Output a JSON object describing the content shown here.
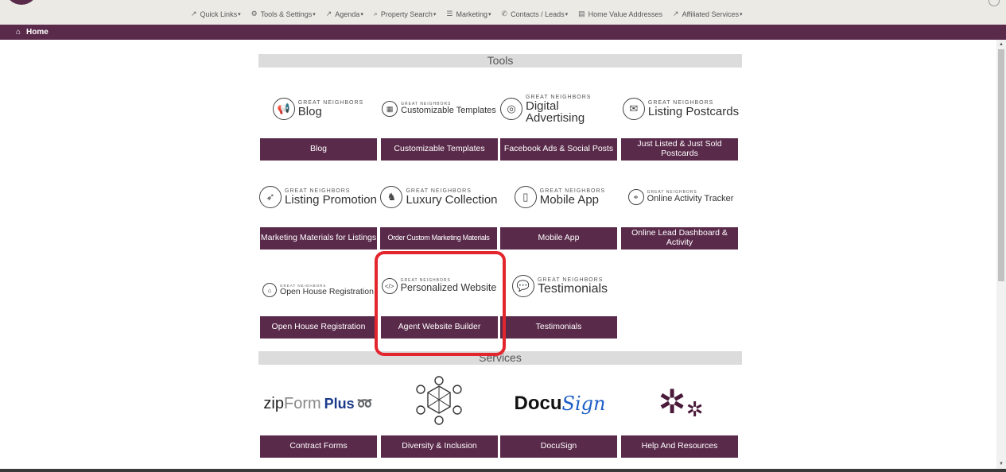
{
  "nav": {
    "items": [
      {
        "label": "Quick Links",
        "icon": "external-link-icon",
        "has_caret": true
      },
      {
        "label": "Tools & Settings",
        "icon": "gears-icon",
        "has_caret": true
      },
      {
        "label": "Agenda",
        "icon": "external-link-icon",
        "has_caret": true
      },
      {
        "label": "Property Search",
        "icon": "search-icon",
        "has_caret": true
      },
      {
        "label": "Marketing",
        "icon": "list-icon",
        "has_caret": true
      },
      {
        "label": "Contacts / Leads",
        "icon": "phone-icon",
        "has_caret": true
      },
      {
        "label": "Home Value Addresses",
        "icon": "document-icon",
        "has_caret": false
      },
      {
        "label": "Affiliated Services",
        "icon": "external-link-icon",
        "has_caret": true
      }
    ]
  },
  "breadcrumb": {
    "home_label": "Home"
  },
  "tools": {
    "title": "Tools",
    "brand_small": "GREAT NEIGHBORS",
    "tiles": [
      {
        "logo": "Blog",
        "button": "Blog",
        "icon": "megaphone-icon"
      },
      {
        "logo": "Customizable Templates",
        "button": "Customizable Templates",
        "icon": "templates-icon"
      },
      {
        "logo": "Digital Advertising",
        "button": "Facebook Ads & Social Posts",
        "icon": "target-icon"
      },
      {
        "logo": "Listing Postcards",
        "button": "Just Listed & Just Sold Postcards",
        "icon": "postcard-icon"
      },
      {
        "logo": "Listing Promotion",
        "button": "Marketing Materials for Listings",
        "icon": "paper-plane-icon"
      },
      {
        "logo": "Luxury Collection",
        "button": "Order Custom Marketing Materials",
        "icon": "chess-icon"
      },
      {
        "logo": "Mobile App",
        "button": "Mobile App",
        "icon": "mobile-icon"
      },
      {
        "logo": "Online Activity Tracker",
        "button": "Online Lead Dashboard & Activity",
        "icon": "activity-icon"
      },
      {
        "logo": "Open House Registration",
        "button": "Open House Registration",
        "icon": "open-house-icon"
      },
      {
        "logo": "Personalized Website",
        "button": "Agent Website Builder",
        "icon": "code-icon"
      },
      {
        "logo": "Testimonials",
        "button": "Testimonials",
        "icon": "chat-icon"
      }
    ]
  },
  "services": {
    "title": "Services",
    "tiles": [
      {
        "logo_a": "zip",
        "logo_b": "Form",
        "logo_c": "Plus",
        "button": "Contract Forms"
      },
      {
        "button": "Diversity & Inclusion"
      },
      {
        "logo_a": "Docu",
        "logo_b": "Sign",
        "button": "DocuSign"
      },
      {
        "button": "Help And Resources"
      }
    ]
  },
  "colors": {
    "brand": "#5a2a4a",
    "highlight": "#e3262e",
    "header_bg": "#dcdcdc"
  }
}
